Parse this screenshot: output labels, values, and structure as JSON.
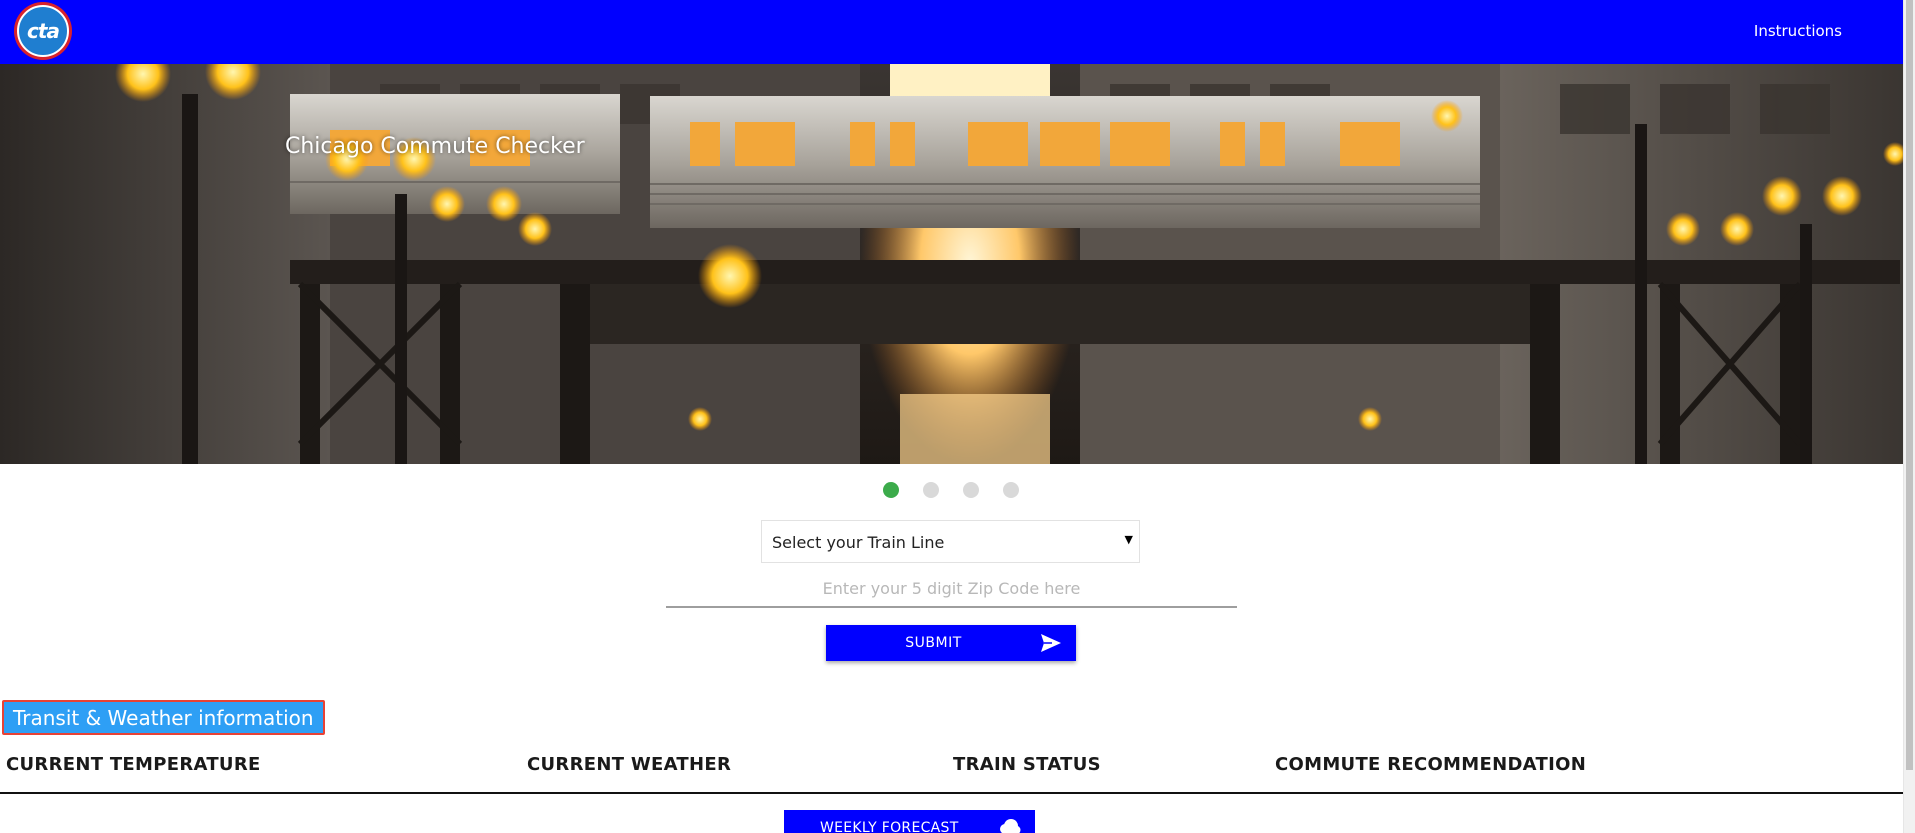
{
  "header": {
    "logo_text": "cta",
    "nav_link": "Instructions",
    "background_color": "#0000ff"
  },
  "hero": {
    "title": "Chicago Commute Checker",
    "carousel": {
      "slide_count": 4,
      "active_index": 0,
      "active_color": "#3cab4b"
    }
  },
  "form": {
    "train_line_select": {
      "selected": "Select your Train Line"
    },
    "zip_input": {
      "placeholder": "Enter your 5 digit Zip Code here",
      "value": ""
    },
    "submit_label": "SUBMIT",
    "submit_icon": "send-icon"
  },
  "info_section": {
    "label": "Transit & Weather information",
    "columns": [
      "CURRENT TEMPERATURE",
      "CURRENT WEATHER",
      "TRAIN STATUS",
      "COMMUTE RECOMMENDATION"
    ],
    "forecast_label": "WEEKLY FORECAST",
    "forecast_icon": "cloud-icon"
  }
}
